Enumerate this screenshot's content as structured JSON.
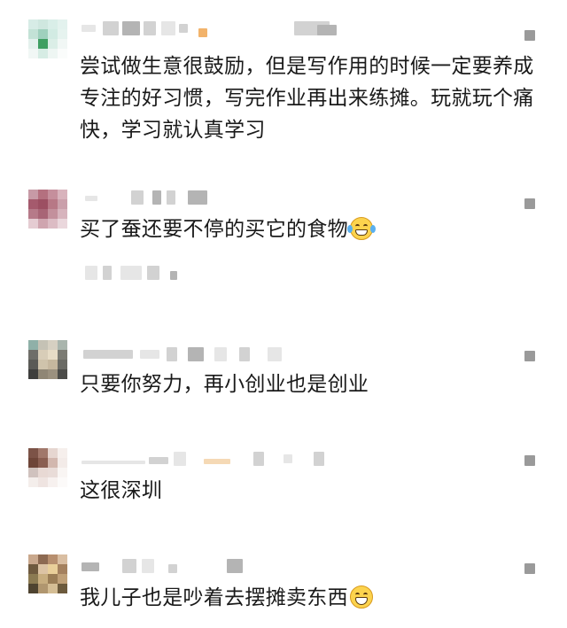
{
  "comments": [
    {
      "text": "尝试做生意很鼓励，但是写作用的时候一定要养成专注的好习惯，写完作业再出来练摊。玩就玩个痛快，学习就认真学习",
      "emoji": null
    },
    {
      "text": "买了蚕还要不停的买它的食物",
      "emoji": "laughing-crying-emoji"
    },
    {
      "text": "只要你努力，再小创业也是创业",
      "emoji": null
    },
    {
      "text": "这很深圳",
      "emoji": null
    },
    {
      "text": "我儿子也是吵着去摆摊卖东西",
      "emoji": "grinning-emoji"
    }
  ],
  "colors": {
    "text": "#1a1a1a",
    "background": "#ffffff",
    "redacted": "#d2d2d2",
    "icon": "#9a9a9a"
  }
}
